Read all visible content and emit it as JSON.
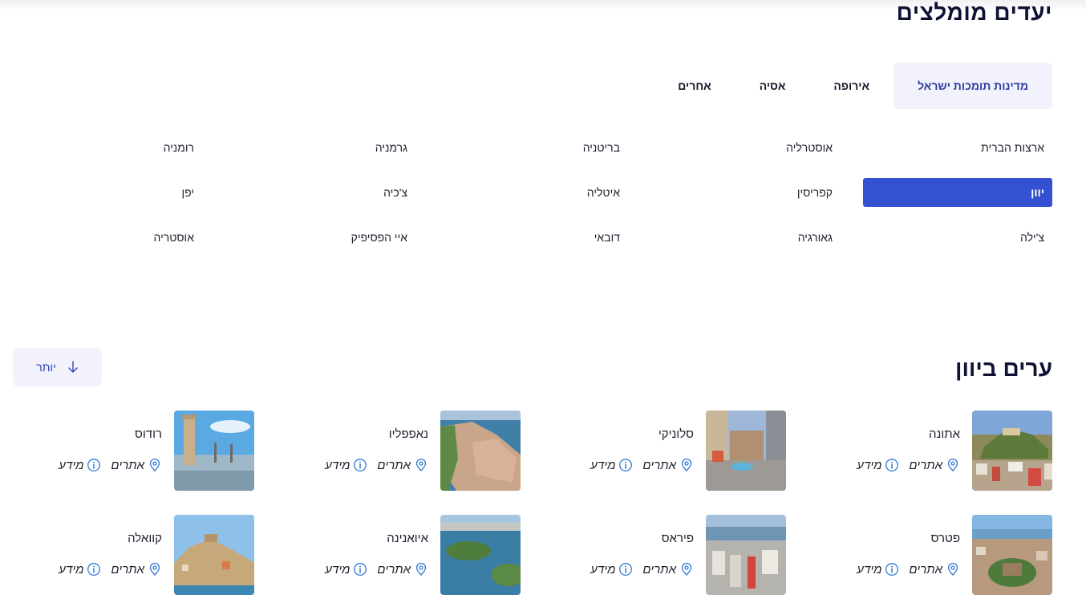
{
  "section": {
    "title": "יעדים מומלצים"
  },
  "tabs": [
    {
      "label": "מדינות תומכות ישראל",
      "active": true
    },
    {
      "label": "אירופה"
    },
    {
      "label": "אסיה"
    },
    {
      "label": "אחרים"
    }
  ],
  "countries": [
    {
      "label": "ארצות הברית"
    },
    {
      "label": "אוסטרליה"
    },
    {
      "label": "בריטניה"
    },
    {
      "label": "גרמניה"
    },
    {
      "label": "רומניה"
    },
    {
      "label": "יוון",
      "selected": true
    },
    {
      "label": "קפריסין"
    },
    {
      "label": "איטליה"
    },
    {
      "label": "צ'כיה"
    },
    {
      "label": "יפן"
    },
    {
      "label": "צ'ילה"
    },
    {
      "label": "גאורגיה"
    },
    {
      "label": "דובאי"
    },
    {
      "label": "איי הפסיפיק"
    },
    {
      "label": "אוסטריה"
    }
  ],
  "cities_section": {
    "title": "ערים ביוון"
  },
  "more_button": {
    "label": "יותר",
    "icon": "arrow-down-icon"
  },
  "action_labels": {
    "sites": "אתרים",
    "info": "מידע"
  },
  "icons": {
    "sites": "map-pin-icon",
    "info": "info-circle-icon"
  },
  "colors": {
    "accent": "#3451d1",
    "heading": "#0f1235",
    "tab_bg": "#f1f2fc",
    "icon": "#2f7bd6"
  },
  "cities": [
    {
      "name": "אתונה"
    },
    {
      "name": "סלוניקי"
    },
    {
      "name": "נאפפליו"
    },
    {
      "name": "רודוס"
    },
    {
      "name": "פטרס"
    },
    {
      "name": "פיראס"
    },
    {
      "name": "איואנינה"
    },
    {
      "name": "קוואלה"
    }
  ]
}
